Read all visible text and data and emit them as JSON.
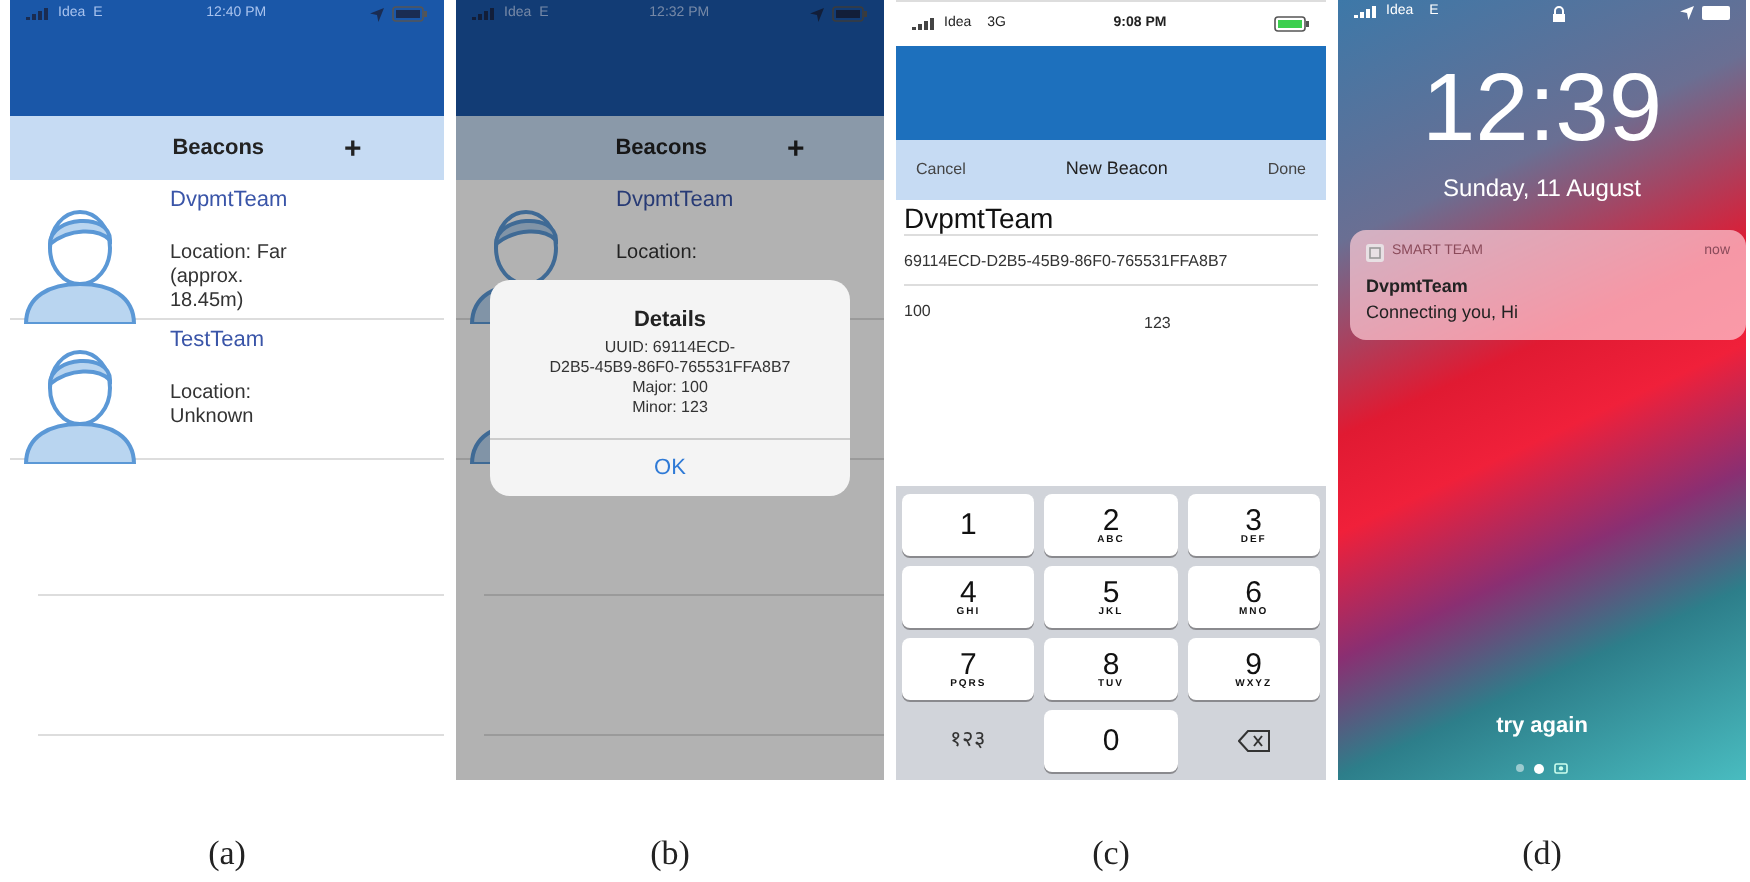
{
  "panels": [
    {
      "kind": "beacon_list",
      "caption": "(a)",
      "status_bar": {
        "carrier": "Idea",
        "network": "E",
        "time": "12:40 PM"
      },
      "nav": {
        "title": "Beacons",
        "add": "+"
      },
      "dimmed": false,
      "rows": [
        {
          "name": "DvpmtTeam",
          "location": "Location: Far (approx. 18.45m)"
        },
        {
          "name": "TestTeam",
          "location": "Location: Unknown"
        }
      ]
    },
    {
      "kind": "beacon_list",
      "caption": "(b)",
      "status_bar": {
        "carrier": "Idea",
        "network": "E",
        "time": "12:32 PM"
      },
      "nav": {
        "title": "Beacons",
        "add": "+"
      },
      "dimmed": true,
      "rows": [
        {
          "name": "DvpmtTeam",
          "location": "Location:"
        },
        {
          "name": "",
          "location": ""
        }
      ],
      "alert": {
        "title": "Details",
        "lines": [
          "UUID: 69114ECD-",
          "D2B5-45B9-86F0-765531FFA8B7",
          "Major: 100",
          "Minor: 123"
        ],
        "button": "OK"
      }
    },
    {
      "kind": "new_beacon",
      "caption": "(c)",
      "status_bar": {
        "carrier": "Idea",
        "network": "3G",
        "time": "9:08 PM"
      },
      "nav": {
        "cancel": "Cancel",
        "title": "New Beacon",
        "done": "Done"
      },
      "form": {
        "name": "DvpmtTeam",
        "uuid": "69114ECD-D2B5-45B9-86F0-765531FFA8B7",
        "major": "100",
        "minor": "123"
      },
      "keys": [
        {
          "kind": "digit",
          "digit": "1"
        },
        {
          "kind": "digit",
          "digit": "2",
          "letters": "ABC"
        },
        {
          "kind": "digit",
          "digit": "3",
          "letters": "DEF"
        },
        {
          "kind": "digit",
          "digit": "4",
          "letters": "GHI"
        },
        {
          "kind": "digit",
          "digit": "5",
          "letters": "JKL"
        },
        {
          "kind": "digit",
          "digit": "6",
          "letters": "MNO"
        },
        {
          "kind": "digit",
          "digit": "7",
          "letters": "PQRS"
        },
        {
          "kind": "digit",
          "digit": "8",
          "letters": "TUV"
        },
        {
          "kind": "digit",
          "digit": "9",
          "letters": "WXYZ"
        },
        {
          "kind": "mode",
          "digit": "१२३"
        },
        {
          "kind": "digit",
          "digit": "0"
        },
        {
          "kind": "delete"
        }
      ]
    },
    {
      "kind": "lock_screen",
      "caption": "(d)",
      "status_bar": {
        "carrier": "Idea",
        "network": "E"
      },
      "clock": "12:39",
      "date": "Sunday, 11 August",
      "notification": {
        "app": "SMART TEAM",
        "when": "now",
        "title": "DvpmtTeam",
        "body": "Connecting you, Hi"
      },
      "hint": "try again",
      "page_dots": [
        {
          "selected": false
        },
        {
          "selected": true
        }
      ]
    }
  ]
}
